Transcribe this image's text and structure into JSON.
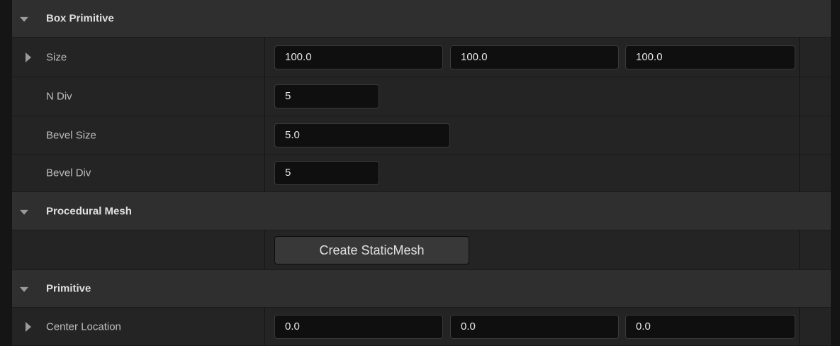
{
  "sections": {
    "box_primitive": {
      "title": "Box Primitive",
      "size": {
        "label": "Size",
        "x": "100.0",
        "y": "100.0",
        "z": "100.0"
      },
      "n_div": {
        "label": "N Div",
        "value": "5"
      },
      "bevel_size": {
        "label": "Bevel Size",
        "value": "5.0"
      },
      "bevel_div": {
        "label": "Bevel Div",
        "value": "5"
      }
    },
    "procedural_mesh": {
      "title": "Procedural Mesh",
      "create_button": "Create StaticMesh"
    },
    "primitive": {
      "title": "Primitive",
      "center_location": {
        "label": "Center Location",
        "x": "0.0",
        "y": "0.0",
        "z": "0.0"
      }
    }
  }
}
